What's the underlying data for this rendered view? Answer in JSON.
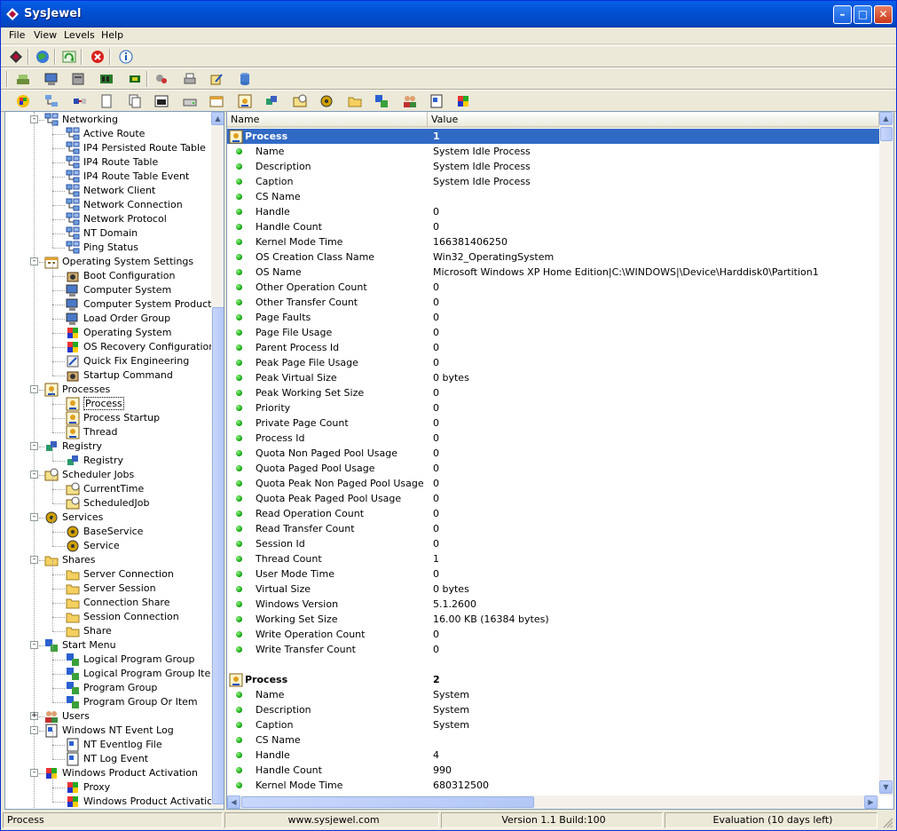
{
  "window": {
    "title": "SysJewel"
  },
  "menu": [
    "File",
    "View",
    "Levels",
    "Help"
  ],
  "tree": [
    {
      "label": "Networking",
      "level": 1,
      "exp": "-",
      "icon": "network"
    },
    {
      "label": "Active Route",
      "level": 2,
      "icon": "network"
    },
    {
      "label": "IP4 Persisted Route Table",
      "level": 2,
      "icon": "network"
    },
    {
      "label": "IP4 Route Table",
      "level": 2,
      "icon": "network"
    },
    {
      "label": "IP4 Route Table Event",
      "level": 2,
      "icon": "network"
    },
    {
      "label": "Network Client",
      "level": 2,
      "icon": "network"
    },
    {
      "label": "Network Connection",
      "level": 2,
      "icon": "network"
    },
    {
      "label": "Network Protocol",
      "level": 2,
      "icon": "network"
    },
    {
      "label": "NT Domain",
      "level": 2,
      "icon": "network"
    },
    {
      "label": "Ping Status",
      "level": 2,
      "icon": "network"
    },
    {
      "label": "Operating System Settings",
      "level": 1,
      "exp": "-",
      "icon": "calendar"
    },
    {
      "label": "Boot Configuration",
      "level": 2,
      "icon": "gear"
    },
    {
      "label": "Computer System",
      "level": 2,
      "icon": "computer"
    },
    {
      "label": "Computer System Product",
      "level": 2,
      "icon": "computer"
    },
    {
      "label": "Load Order Group",
      "level": 2,
      "icon": "computer"
    },
    {
      "label": "Operating System",
      "level": 2,
      "icon": "windows"
    },
    {
      "label": "OS Recovery Configuration",
      "level": 2,
      "icon": "windows"
    },
    {
      "label": "Quick Fix Engineering",
      "level": 2,
      "icon": "wrench"
    },
    {
      "label": "Startup Command",
      "level": 2,
      "icon": "gear"
    },
    {
      "label": "Processes",
      "level": 1,
      "exp": "-",
      "icon": "process"
    },
    {
      "label": "Process",
      "level": 2,
      "icon": "process",
      "selected": true
    },
    {
      "label": "Process Startup",
      "level": 2,
      "icon": "process"
    },
    {
      "label": "Thread",
      "level": 2,
      "icon": "process"
    },
    {
      "label": "Registry",
      "level": 1,
      "exp": "-",
      "icon": "registry"
    },
    {
      "label": "Registry",
      "level": 2,
      "icon": "registry"
    },
    {
      "label": "Scheduler Jobs",
      "level": 1,
      "exp": "-",
      "icon": "folder"
    },
    {
      "label": "CurrentTime",
      "level": 2,
      "icon": "folder"
    },
    {
      "label": "ScheduledJob",
      "level": 2,
      "icon": "folder"
    },
    {
      "label": "Services",
      "level": 1,
      "exp": "-",
      "icon": "service"
    },
    {
      "label": "BaseService",
      "level": 2,
      "icon": "service"
    },
    {
      "label": "Service",
      "level": 2,
      "icon": "service"
    },
    {
      "label": "Shares",
      "level": 1,
      "exp": "-",
      "icon": "share"
    },
    {
      "label": "Server Connection",
      "level": 2,
      "icon": "share"
    },
    {
      "label": "Server Session",
      "level": 2,
      "icon": "share"
    },
    {
      "label": "Connection Share",
      "level": 2,
      "icon": "share"
    },
    {
      "label": "Session Connection",
      "level": 2,
      "icon": "share"
    },
    {
      "label": "Share",
      "level": 2,
      "icon": "share"
    },
    {
      "label": "Start Menu",
      "level": 1,
      "exp": "-",
      "icon": "startmenu"
    },
    {
      "label": "Logical Program Group",
      "level": 2,
      "icon": "startmenu"
    },
    {
      "label": "Logical Program Group Item",
      "level": 2,
      "icon": "startmenu"
    },
    {
      "label": "Program Group",
      "level": 2,
      "icon": "startmenu"
    },
    {
      "label": "Program Group Or Item",
      "level": 2,
      "icon": "startmenu"
    },
    {
      "label": "Users",
      "level": 1,
      "exp": "+",
      "icon": "users"
    },
    {
      "label": "Windows NT Event Log",
      "level": 1,
      "exp": "-",
      "icon": "eventlog"
    },
    {
      "label": "NT Eventlog File",
      "level": 2,
      "icon": "eventlog"
    },
    {
      "label": "NT Log Event",
      "level": 2,
      "icon": "eventlog"
    },
    {
      "label": "Windows Product Activation",
      "level": 1,
      "exp": "-",
      "icon": "windows"
    },
    {
      "label": "Proxy",
      "level": 2,
      "icon": "windows"
    },
    {
      "label": "Windows Product Activation",
      "level": 2,
      "icon": "windows"
    }
  ],
  "list": {
    "col_name": "Name",
    "col_value": "Value",
    "rows": [
      {
        "type": "group",
        "name": "Process",
        "value": "1",
        "selected": true
      },
      {
        "name": "Name",
        "value": "System Idle Process"
      },
      {
        "name": "Description",
        "value": "System Idle Process"
      },
      {
        "name": "Caption",
        "value": "System Idle Process"
      },
      {
        "name": "CS Name",
        "value": ""
      },
      {
        "name": "Handle",
        "value": "0"
      },
      {
        "name": "Handle Count",
        "value": "0"
      },
      {
        "name": "Kernel Mode Time",
        "value": "166381406250"
      },
      {
        "name": "OS Creation Class Name",
        "value": "Win32_OperatingSystem"
      },
      {
        "name": "OS Name",
        "value": "Microsoft Windows XP Home Edition|C:\\WINDOWS|\\Device\\Harddisk0\\Partition1"
      },
      {
        "name": "Other Operation Count",
        "value": "0"
      },
      {
        "name": "Other Transfer Count",
        "value": "0"
      },
      {
        "name": "Page Faults",
        "value": "0"
      },
      {
        "name": "Page File Usage",
        "value": "0"
      },
      {
        "name": "Parent Process Id",
        "value": "0"
      },
      {
        "name": "Peak Page File Usage",
        "value": "0"
      },
      {
        "name": "Peak Virtual Size",
        "value": "0 bytes"
      },
      {
        "name": "Peak Working Set Size",
        "value": "0"
      },
      {
        "name": "Priority",
        "value": "0"
      },
      {
        "name": "Private Page Count",
        "value": "0"
      },
      {
        "name": "Process Id",
        "value": "0"
      },
      {
        "name": "Quota Non Paged Pool Usage",
        "value": "0"
      },
      {
        "name": "Quota Paged Pool Usage",
        "value": "0"
      },
      {
        "name": "Quota Peak Non Paged Pool Usage",
        "value": "0"
      },
      {
        "name": "Quota Peak Paged Pool Usage",
        "value": "0"
      },
      {
        "name": "Read Operation Count",
        "value": "0"
      },
      {
        "name": "Read Transfer Count",
        "value": "0"
      },
      {
        "name": "Session Id",
        "value": "0"
      },
      {
        "name": "Thread Count",
        "value": "1"
      },
      {
        "name": "User Mode Time",
        "value": "0"
      },
      {
        "name": "Virtual Size",
        "value": "0 bytes"
      },
      {
        "name": "Windows Version",
        "value": "5.1.2600"
      },
      {
        "name": "Working Set Size",
        "value": "16.00 KB (16384 bytes)"
      },
      {
        "name": "Write Operation Count",
        "value": "0"
      },
      {
        "name": "Write Transfer Count",
        "value": "0"
      },
      {
        "type": "blank",
        "name": "",
        "value": ""
      },
      {
        "type": "group",
        "name": "Process",
        "value": "2"
      },
      {
        "name": "Name",
        "value": "System"
      },
      {
        "name": "Description",
        "value": "System"
      },
      {
        "name": "Caption",
        "value": "System"
      },
      {
        "name": "CS Name",
        "value": ""
      },
      {
        "name": "Handle",
        "value": "4"
      },
      {
        "name": "Handle Count",
        "value": "990"
      },
      {
        "name": "Kernel Mode Time",
        "value": "680312500"
      }
    ]
  },
  "status": {
    "selection": "Process",
    "website": "www.sysjewel.com",
    "version": "Version 1.1 Build:100",
    "license": "Evaluation (10 days left)"
  }
}
